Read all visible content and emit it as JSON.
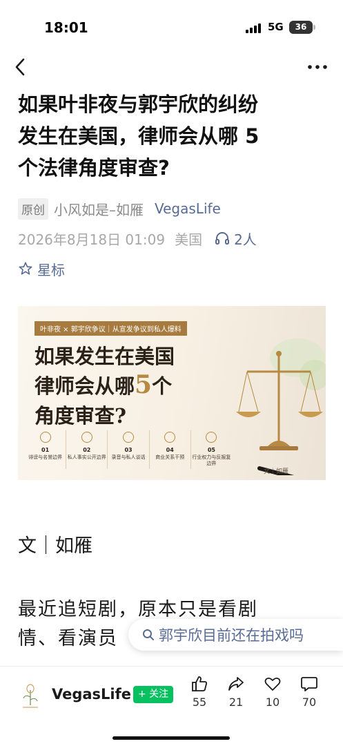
{
  "status_bar": {
    "time": "18:01",
    "network": "5G",
    "battery": "36"
  },
  "nav": {
    "back_icon": "chevron-left-icon",
    "more_icon": "ellipsis-icon"
  },
  "article": {
    "title_lines": [
      "如果叶非夜与郭宇欣的纠纷",
      "发生在美国，律师会从哪 5",
      "个法律角度审查?"
    ],
    "original_badge": "原创",
    "author": "小风如是–如雁",
    "account": "VegasLife",
    "date": "2026年8月18日 01:09",
    "location": "美国",
    "listeners": "2人",
    "star_label": "星标",
    "byline": "文｜如雁",
    "body_lines": [
      "最近追短剧，原本只是看剧",
      "情、看演员"
    ]
  },
  "banner": {
    "tag": "叶非夜 × 郭宇欣争议｜从宣发争议到私人爆料",
    "heading_line1": "如果发生在美国",
    "heading_line2_pre": "律师会从哪",
    "heading_line2_num": "5",
    "heading_line2_post": "个",
    "heading_line3": "角度审查?",
    "items": [
      {
        "num": "01",
        "label": "诽谤与名誉边界"
      },
      {
        "num": "02",
        "label": "私人事实公开边界"
      },
      {
        "num": "03",
        "label": "录音与私人谈话"
      },
      {
        "num": "04",
        "label": "商业关系干预"
      },
      {
        "num": "05",
        "label": "行业权力与反报复边界"
      }
    ],
    "author": "文｜如雁"
  },
  "search_suggestion": {
    "text": "郭宇欣目前还在拍戏吗",
    "icon": "search-icon"
  },
  "bottom_bar": {
    "account_name": "VegasLife",
    "follow_label": "+ 关注",
    "likes": "55",
    "shares": "21",
    "favorites": "10",
    "comments": "70"
  },
  "colors": {
    "link": "#576b95",
    "follow_green": "#07c160",
    "banner_gold": "#b68a43"
  }
}
